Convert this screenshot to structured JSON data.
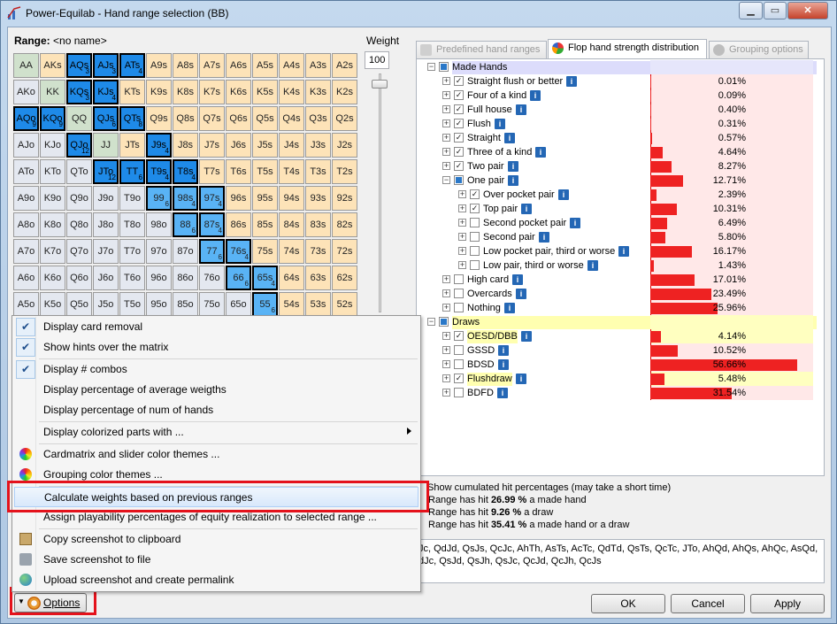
{
  "window": {
    "title": "Power-Equilab - Hand range selection (BB)",
    "minimize": "▁",
    "maximize": "▭",
    "close": "✕"
  },
  "range": {
    "label": "Range:",
    "name": "<no name>"
  },
  "weight": {
    "label": "Weight",
    "value": "100"
  },
  "matrix": {
    "rows": [
      [
        "AA",
        "AKs",
        "AQs",
        "AJs",
        "ATs",
        "A9s",
        "A8s",
        "A7s",
        "A6s",
        "A5s",
        "A4s",
        "A3s",
        "A2s"
      ],
      [
        "AKo",
        "KK",
        "KQs",
        "KJs",
        "KTs",
        "K9s",
        "K8s",
        "K7s",
        "K6s",
        "K5s",
        "K4s",
        "K3s",
        "K2s"
      ],
      [
        "AQo",
        "KQo",
        "QQ",
        "QJs",
        "QTs",
        "Q9s",
        "Q8s",
        "Q7s",
        "Q6s",
        "Q5s",
        "Q4s",
        "Q3s",
        "Q2s"
      ],
      [
        "AJo",
        "KJo",
        "QJo",
        "JJ",
        "JTs",
        "J9s",
        "J8s",
        "J7s",
        "J6s",
        "J5s",
        "J4s",
        "J3s",
        "J2s"
      ],
      [
        "ATo",
        "KTo",
        "QTo",
        "JTo",
        "TT",
        "T9s",
        "T8s",
        "T7s",
        "T6s",
        "T5s",
        "T4s",
        "T3s",
        "T2s"
      ],
      [
        "A9o",
        "K9o",
        "Q9o",
        "J9o",
        "T9o",
        "99",
        "98s",
        "97s",
        "96s",
        "95s",
        "94s",
        "93s",
        "92s"
      ],
      [
        "A8o",
        "K8o",
        "Q8o",
        "J8o",
        "T8o",
        "98o",
        "88",
        "87s",
        "86s",
        "85s",
        "84s",
        "83s",
        "82s"
      ],
      [
        "A7o",
        "K7o",
        "Q7o",
        "J7o",
        "T7o",
        "97o",
        "87o",
        "77",
        "76s",
        "75s",
        "74s",
        "73s",
        "72s"
      ],
      [
        "A6o",
        "K6o",
        "Q6o",
        "J6o",
        "T6o",
        "96o",
        "86o",
        "76o",
        "66",
        "65s",
        "64s",
        "63s",
        "62s"
      ],
      [
        "A5o",
        "K5o",
        "Q5o",
        "J5o",
        "T5o",
        "95o",
        "85o",
        "75o",
        "65o",
        "55",
        "54s",
        "53s",
        "52s"
      ]
    ],
    "selected": [
      [
        0,
        2,
        "3"
      ],
      [
        0,
        3,
        "3"
      ],
      [
        0,
        4,
        "4"
      ],
      [
        1,
        2,
        "3"
      ],
      [
        1,
        3,
        "4"
      ],
      [
        2,
        0,
        "9"
      ],
      [
        2,
        1,
        "9"
      ],
      [
        2,
        3,
        "6"
      ],
      [
        2,
        4,
        "8"
      ],
      [
        3,
        2,
        "12"
      ],
      [
        3,
        5,
        "4"
      ],
      [
        4,
        3,
        "12"
      ],
      [
        4,
        4,
        "6"
      ],
      [
        4,
        5,
        "4"
      ],
      [
        4,
        6,
        "4"
      ]
    ],
    "light": [
      [
        5,
        5,
        "6"
      ],
      [
        5,
        6,
        "4"
      ],
      [
        5,
        7,
        "4"
      ],
      [
        6,
        6,
        "6"
      ],
      [
        6,
        7,
        "4"
      ],
      [
        7,
        7,
        "6"
      ],
      [
        7,
        8,
        "4"
      ],
      [
        8,
        8,
        "6"
      ],
      [
        8,
        9,
        "4"
      ],
      [
        9,
        9,
        "6"
      ]
    ]
  },
  "tabs": [
    {
      "label": "Predefined hand ranges",
      "active": false
    },
    {
      "label": "Flop hand strength distribution",
      "active": true
    },
    {
      "label": "Grouping options",
      "active": false
    }
  ],
  "tree": [
    {
      "label": "Made Hands",
      "level": 0,
      "group": "made",
      "expander": "−",
      "check": "sq",
      "pct": null
    },
    {
      "label": "Straight flush or better",
      "level": 1,
      "expander": "+",
      "check": "✓",
      "info": true,
      "pct": "0.01%",
      "value": 0.01
    },
    {
      "label": "Four of a kind",
      "level": 1,
      "expander": "+",
      "check": "✓",
      "info": true,
      "pct": "0.09%",
      "value": 0.09
    },
    {
      "label": "Full house",
      "level": 1,
      "expander": "+",
      "check": "✓",
      "info": true,
      "pct": "0.40%",
      "value": 0.4
    },
    {
      "label": "Flush",
      "level": 1,
      "expander": "+",
      "check": "✓",
      "info": true,
      "pct": "0.31%",
      "value": 0.31
    },
    {
      "label": "Straight",
      "level": 1,
      "expander": "+",
      "check": "✓",
      "info": true,
      "pct": "0.57%",
      "value": 0.57
    },
    {
      "label": "Three of a kind",
      "level": 1,
      "expander": "+",
      "check": "✓",
      "info": true,
      "pct": "4.64%",
      "value": 4.64
    },
    {
      "label": "Two pair",
      "level": 1,
      "expander": "+",
      "check": "✓",
      "info": true,
      "pct": "8.27%",
      "value": 8.27
    },
    {
      "label": "One pair",
      "level": 1,
      "expander": "−",
      "check": "sq",
      "info": true,
      "pct": "12.71%",
      "value": 12.71
    },
    {
      "label": "Over pocket pair",
      "level": 2,
      "expander": "+",
      "check": "✓",
      "info": true,
      "pct": "2.39%",
      "value": 2.39
    },
    {
      "label": "Top pair",
      "level": 2,
      "expander": "+",
      "check": "✓",
      "info": true,
      "pct": "10.31%",
      "value": 10.31
    },
    {
      "label": "Second pocket pair",
      "level": 2,
      "expander": "+",
      "check": "",
      "info": true,
      "pct": "6.49%",
      "value": 6.49
    },
    {
      "label": "Second pair",
      "level": 2,
      "expander": "+",
      "check": "",
      "info": true,
      "pct": "5.80%",
      "value": 5.8
    },
    {
      "label": "Low pocket pair, third or worse",
      "level": 2,
      "expander": "+",
      "check": "",
      "info": true,
      "pct": "16.17%",
      "value": 16.17
    },
    {
      "label": "Low pair, third or worse",
      "level": 2,
      "expander": "+",
      "check": "",
      "info": true,
      "pct": "1.43%",
      "value": 1.43
    },
    {
      "label": "High card",
      "level": 1,
      "expander": "+",
      "check": "",
      "info": true,
      "pct": "17.01%",
      "value": 17.01
    },
    {
      "label": "Overcards",
      "level": 1,
      "expander": "+",
      "check": "",
      "info": true,
      "pct": "23.49%",
      "value": 23.49
    },
    {
      "label": "Nothing",
      "level": 1,
      "expander": "+",
      "check": "",
      "info": true,
      "pct": "25.96%",
      "value": 25.96
    },
    {
      "label": "Draws",
      "level": 0,
      "group": "draws",
      "expander": "−",
      "check": "sq",
      "pct": null
    },
    {
      "label": "OESD/DBB",
      "level": 1,
      "expander": "+",
      "check": "✓",
      "info": true,
      "pct": "4.14%",
      "value": 4.14,
      "yellow": true
    },
    {
      "label": "GSSD",
      "level": 1,
      "expander": "+",
      "check": "",
      "info": true,
      "pct": "10.52%",
      "value": 10.52
    },
    {
      "label": "BDSD",
      "level": 1,
      "expander": "+",
      "check": "",
      "info": true,
      "pct": "56.66%",
      "value": 56.66
    },
    {
      "label": "Flushdraw",
      "level": 1,
      "expander": "+",
      "check": "✓",
      "info": true,
      "pct": "5.48%",
      "value": 5.48,
      "yellow": true
    },
    {
      "label": "BDFD",
      "level": 1,
      "expander": "+",
      "check": "",
      "info": true,
      "pct": "31.54%",
      "value": 31.54
    }
  ],
  "cumulated": {
    "checkbox_label": "Show cumulated hit percentages (may take a short time)",
    "line1_pre": "Range has hit ",
    "line1_val": "26.99 %",
    "line1_post": " a made hand",
    "line2_pre": "Range has hit ",
    "line2_val": "9.26 %",
    "line2_post": " a draw",
    "line3_pre": "Range has hit ",
    "line3_val": "35.41 %",
    "line3_post": " a made hand or a draw"
  },
  "combos": {
    "line1": "Jc, QdJd, QsJs, QcJc, AhTh, AsTs, AcTc, QdTd, QsTs, QcTc, JTo, AhQd, AhQs, AhQc, AsQd,",
    "line2": "dJc, QsJd, QsJh, QsJc, QcJd, QcJh, QcJs"
  },
  "buttons": {
    "ok": "OK",
    "cancel": "Cancel",
    "apply": "Apply",
    "options": "Options"
  },
  "menu": [
    {
      "label": "Display card removal",
      "checked": true
    },
    {
      "label": "Show hints over the matrix",
      "checked": true
    },
    {
      "sep": true
    },
    {
      "label": "Display # combos",
      "checked": true
    },
    {
      "label": "Display percentage of average weigths",
      "checked": false
    },
    {
      "label": "Display percentage of num of hands",
      "checked": false
    },
    {
      "sep": true
    },
    {
      "label": "Display colorized parts with ...",
      "submenu": true
    },
    {
      "sep": true
    },
    {
      "label": "Cardmatrix and slider color themes ...",
      "icon": "color-wheel-icon"
    },
    {
      "label": "Grouping color themes ...",
      "icon": "color-wheel-icon"
    },
    {
      "sep": true
    },
    {
      "label": "Calculate weights based on previous ranges",
      "highlight": true
    },
    {
      "label": "Assign playability percentages of equity realization to selected range ..."
    },
    {
      "sep": true
    },
    {
      "label": "Copy screenshot to clipboard",
      "icon": "clipboard-icon"
    },
    {
      "label": "Save screenshot to file",
      "icon": "camera-icon"
    },
    {
      "label": "Upload screenshot and create permalink",
      "icon": "globe-icon"
    }
  ],
  "colors": {
    "selected": "#1e8ae8",
    "light": "#59b3f5",
    "pair": "#d0e1cc",
    "suited": "#fde3b8",
    "offsuit": "#e4e8f0",
    "bar": "#ee2222",
    "highlight_frame": "#e4121b"
  }
}
